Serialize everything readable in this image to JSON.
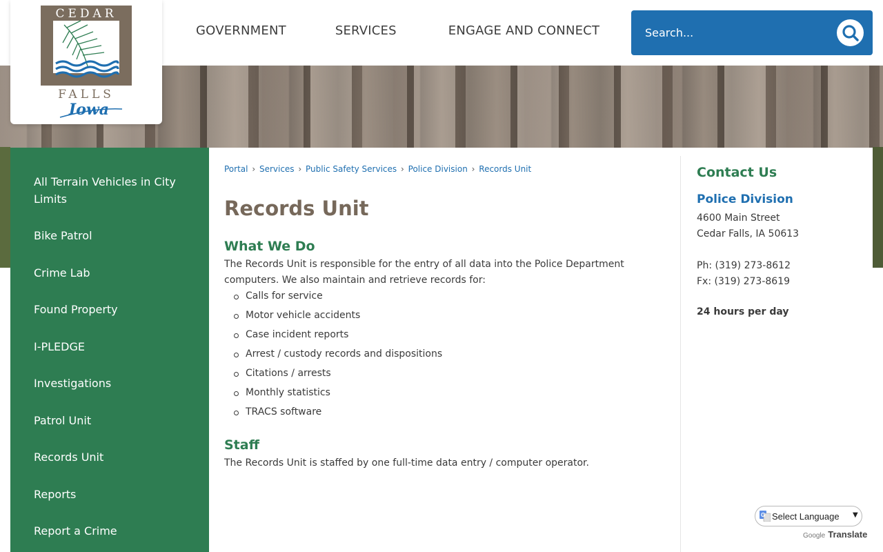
{
  "logo": {
    "top_text": "CEDAR",
    "bottom_text": "FALLS",
    "script_text": "Iowa"
  },
  "nav": {
    "items": [
      "GOVERNMENT",
      "SERVICES",
      "ENGAGE AND CONNECT"
    ]
  },
  "search": {
    "placeholder": "Search..."
  },
  "sidebar": {
    "items": [
      "All Terrain Vehicles in City Limits",
      "Bike Patrol",
      "Crime Lab",
      "Found Property",
      "I-PLEDGE",
      "Investigations",
      "Patrol Unit",
      "Records Unit",
      "Reports",
      "Report a Crime"
    ]
  },
  "breadcrumb": {
    "items": [
      "Portal",
      "Services",
      "Public Safety Services",
      "Police Division",
      "Records Unit"
    ],
    "separator": "›"
  },
  "main": {
    "title": "Records Unit",
    "section1_heading": "What We Do",
    "section1_text": "The Records Unit is responsible for the entry of all data into the Police Department computers. We also maintain and retrieve records for:",
    "bullets": [
      "Calls for service",
      "Motor vehicle accidents",
      "Case incident reports",
      "Arrest / custody records and dispositions",
      "Citations / arrests",
      "Monthly statistics",
      "TRACS software"
    ],
    "section2_heading": "Staff",
    "section2_text": "The Records Unit is staffed by one full-time data entry / computer operator."
  },
  "contact": {
    "title": "Contact Us",
    "org": "Police Division",
    "address1": "4600 Main Street",
    "address2": "Cedar Falls, IA 50613",
    "phone": "Ph: (319) 273-8612",
    "fax": "Fx: (319) 273-8619",
    "hours": "24 hours per day"
  },
  "translate": {
    "select_label": "Select Language",
    "powered_by": "Google",
    "translate_label": "Translate"
  },
  "colors": {
    "brand_green": "#2e7d52",
    "brand_blue": "#1f6fb0",
    "title_brown": "#76685a"
  }
}
